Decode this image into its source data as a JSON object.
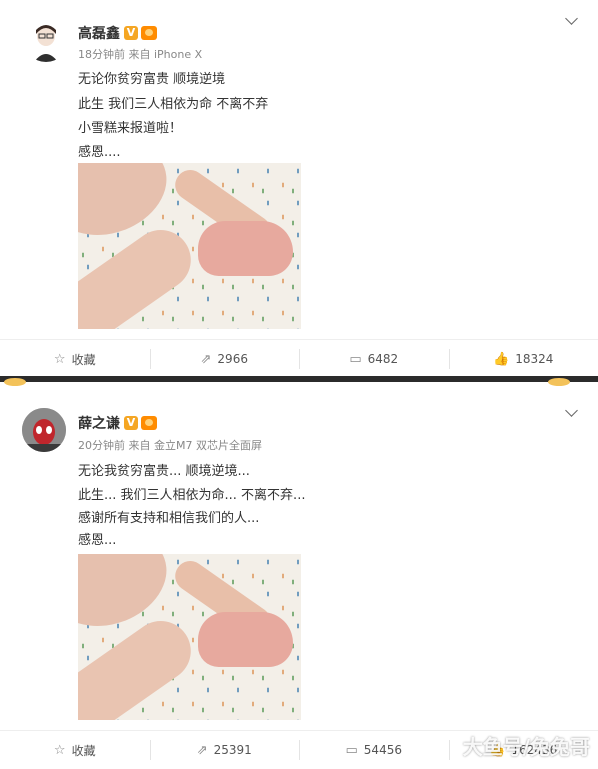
{
  "posts": [
    {
      "username": "高磊鑫",
      "verified_badge": "V",
      "meta": "18分钟前 来自 iPhone X",
      "lines": [
        "无论你贫穷富贵 顺境逆境",
        "此生 我们三人相依为命 不离不弃",
        "小雪糕来报道啦！",
        "感恩...."
      ],
      "actions": {
        "favorite": "收藏",
        "repost": "2966",
        "comment": "6482",
        "like": "18324"
      }
    },
    {
      "username": "薛之谦",
      "verified_badge": "V",
      "meta": "20分钟前 来自 金立M7 双芯片全面屏",
      "lines": [
        "无论我贫穷富贵... 顺境逆境...",
        "此生... 我们三人相依为命... 不离不弃...",
        "感谢所有支持和相信我们的人...",
        "感恩..."
      ],
      "actions": {
        "favorite": "收藏",
        "repost": "25391",
        "comment": "54456",
        "like": "162436"
      }
    }
  ],
  "icons": {
    "favorite": "star-icon",
    "repost": "share-icon",
    "comment": "comment-icon",
    "like": "thumbs-up-icon"
  },
  "colors": {
    "badge": "#f5a623",
    "separator": "#2b2b2b"
  },
  "watermark": "大鱼号/兔兔哥"
}
